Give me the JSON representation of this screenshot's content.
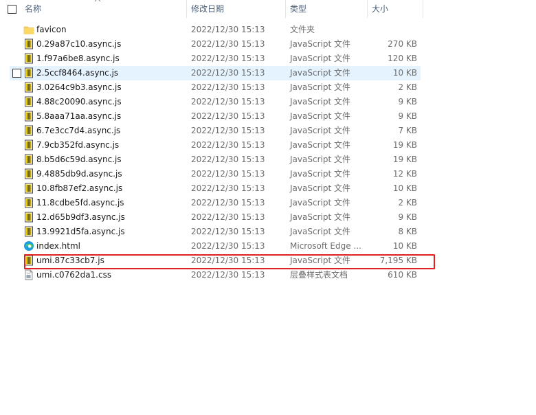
{
  "columns": {
    "name": "名称",
    "date": "修改日期",
    "type": "类型",
    "size": "大小"
  },
  "colors": {
    "highlight": "#e02020",
    "hover_row": "#e5f3ff",
    "header_text": "#4c607a"
  },
  "files": [
    {
      "name": "favicon",
      "date": "2022/12/30 15:13",
      "type": "文件夹",
      "size": "",
      "icon": "folder-icon"
    },
    {
      "name": "0.29a87c10.async.js",
      "date": "2022/12/30 15:13",
      "type": "JavaScript 文件",
      "size": "270 KB",
      "icon": "js-file-icon"
    },
    {
      "name": "1.f97a6be8.async.js",
      "date": "2022/12/30 15:13",
      "type": "JavaScript 文件",
      "size": "120 KB",
      "icon": "js-file-icon"
    },
    {
      "name": "2.5ccf8464.async.js",
      "date": "2022/12/30 15:13",
      "type": "JavaScript 文件",
      "size": "10 KB",
      "icon": "js-file-icon"
    },
    {
      "name": "3.0264c9b3.async.js",
      "date": "2022/12/30 15:13",
      "type": "JavaScript 文件",
      "size": "2 KB",
      "icon": "js-file-icon"
    },
    {
      "name": "4.88c20090.async.js",
      "date": "2022/12/30 15:13",
      "type": "JavaScript 文件",
      "size": "9 KB",
      "icon": "js-file-icon"
    },
    {
      "name": "5.8aaa71aa.async.js",
      "date": "2022/12/30 15:13",
      "type": "JavaScript 文件",
      "size": "9 KB",
      "icon": "js-file-icon"
    },
    {
      "name": "6.7e3cc7d4.async.js",
      "date": "2022/12/30 15:13",
      "type": "JavaScript 文件",
      "size": "7 KB",
      "icon": "js-file-icon"
    },
    {
      "name": "7.9cb352fd.async.js",
      "date": "2022/12/30 15:13",
      "type": "JavaScript 文件",
      "size": "19 KB",
      "icon": "js-file-icon"
    },
    {
      "name": "8.b5d6c59d.async.js",
      "date": "2022/12/30 15:13",
      "type": "JavaScript 文件",
      "size": "19 KB",
      "icon": "js-file-icon"
    },
    {
      "name": "9.4885db9d.async.js",
      "date": "2022/12/30 15:13",
      "type": "JavaScript 文件",
      "size": "12 KB",
      "icon": "js-file-icon"
    },
    {
      "name": "10.8fb87ef2.async.js",
      "date": "2022/12/30 15:13",
      "type": "JavaScript 文件",
      "size": "10 KB",
      "icon": "js-file-icon"
    },
    {
      "name": "11.8cdbe5fd.async.js",
      "date": "2022/12/30 15:13",
      "type": "JavaScript 文件",
      "size": "2 KB",
      "icon": "js-file-icon"
    },
    {
      "name": "12.d65b9df3.async.js",
      "date": "2022/12/30 15:13",
      "type": "JavaScript 文件",
      "size": "9 KB",
      "icon": "js-file-icon"
    },
    {
      "name": "13.9921d5fa.async.js",
      "date": "2022/12/30 15:13",
      "type": "JavaScript 文件",
      "size": "8 KB",
      "icon": "js-file-icon"
    },
    {
      "name": "index.html",
      "date": "2022/12/30 15:13",
      "type": "Microsoft Edge ...",
      "size": "10 KB",
      "icon": "edge-icon"
    },
    {
      "name": "umi.87c33cb7.js",
      "date": "2022/12/30 15:13",
      "type": "JavaScript 文件",
      "size": "7,195 KB",
      "icon": "js-file-icon"
    },
    {
      "name": "umi.c0762da1.css",
      "date": "2022/12/30 15:13",
      "type": "层叠样式表文档",
      "size": "610 KB",
      "icon": "css-file-icon"
    }
  ]
}
